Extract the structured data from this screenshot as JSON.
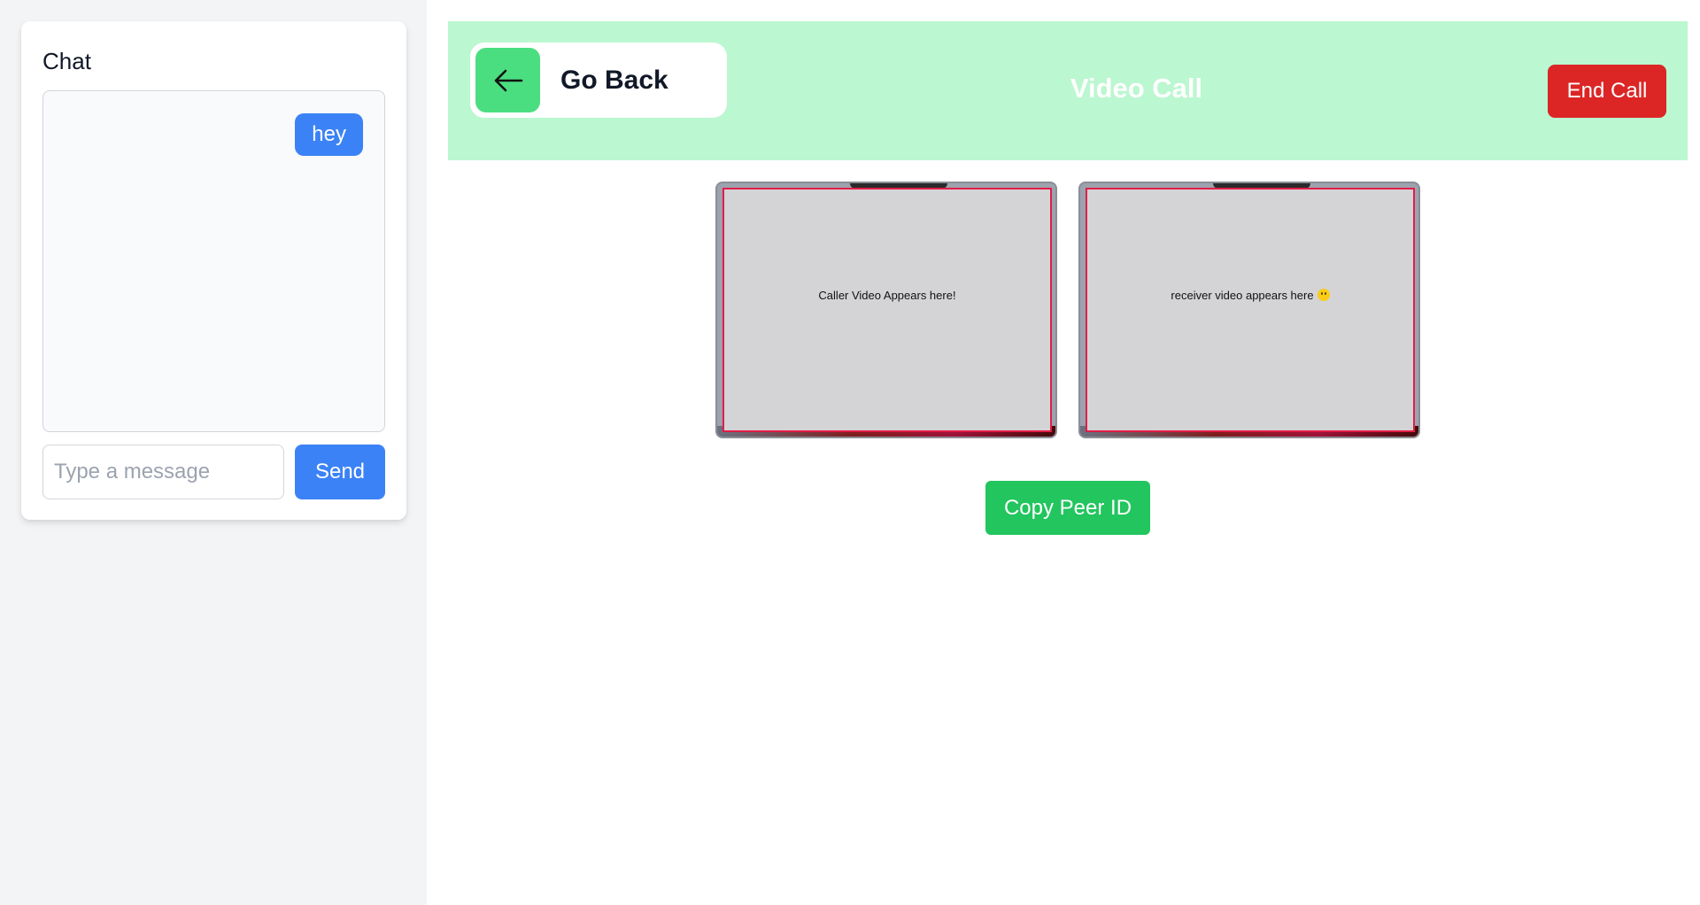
{
  "chat": {
    "title": "Chat",
    "messages": [
      {
        "text": "hey",
        "sender": "self"
      }
    ],
    "input_placeholder": "Type a message",
    "input_value": "",
    "send_label": "Send"
  },
  "header": {
    "back_label": "Go Back",
    "back_icon": "arrow-left-icon",
    "title": "Video Call",
    "end_call_label": "End Call"
  },
  "videos": {
    "caller_text": "Caller Video Appears here!",
    "receiver_text": "receiver video appears here",
    "receiver_emoji_icon": "smiley-face-icon"
  },
  "actions": {
    "copy_peer_label": "Copy Peer ID"
  },
  "colors": {
    "chat_accent": "#3b82f6",
    "header_bg": "#bbf7d0",
    "back_icon_bg": "#4ade80",
    "end_call": "#dc2626",
    "copy_peer": "#22c55e",
    "video_border": "#e11d48"
  }
}
